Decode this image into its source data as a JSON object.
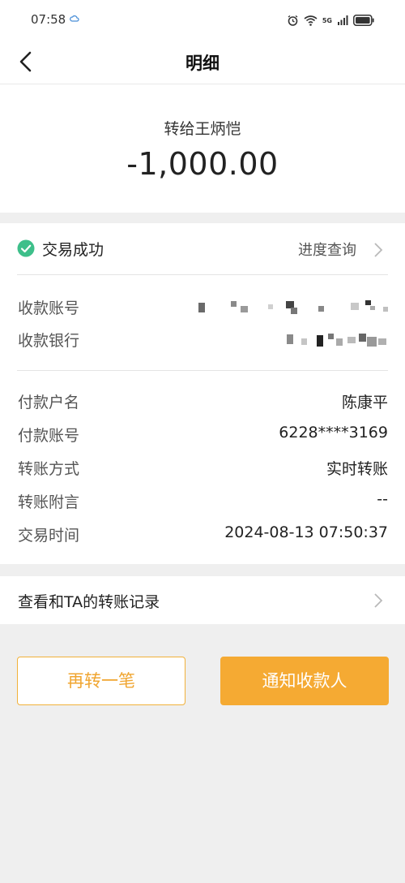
{
  "status_bar": {
    "time": "07:58",
    "network_label": "5G"
  },
  "nav": {
    "title": "明细"
  },
  "summary": {
    "payee_line": "转给王炳恺",
    "amount": "-1,000.00"
  },
  "transaction": {
    "status": "交易成功",
    "progress_link": "进度查询",
    "status_color": "#3ebf8a"
  },
  "recipient": {
    "account_label": "收款账号",
    "bank_label": "收款银行"
  },
  "details": [
    {
      "label": "付款户名",
      "value": "陈康平"
    },
    {
      "label": "付款账号",
      "value": "6228****3169"
    },
    {
      "label": "转账方式",
      "value": "实时转账"
    },
    {
      "label": "转账附言",
      "value": "--"
    },
    {
      "label": "交易时间",
      "value": "2024-08-13 07:50:37"
    }
  ],
  "history_link": "查看和TA的转账记录",
  "buttons": {
    "again": "再转一笔",
    "notify": "通知收款人"
  },
  "colors": {
    "accent": "#f5aa33",
    "success": "#3ebf8a"
  }
}
